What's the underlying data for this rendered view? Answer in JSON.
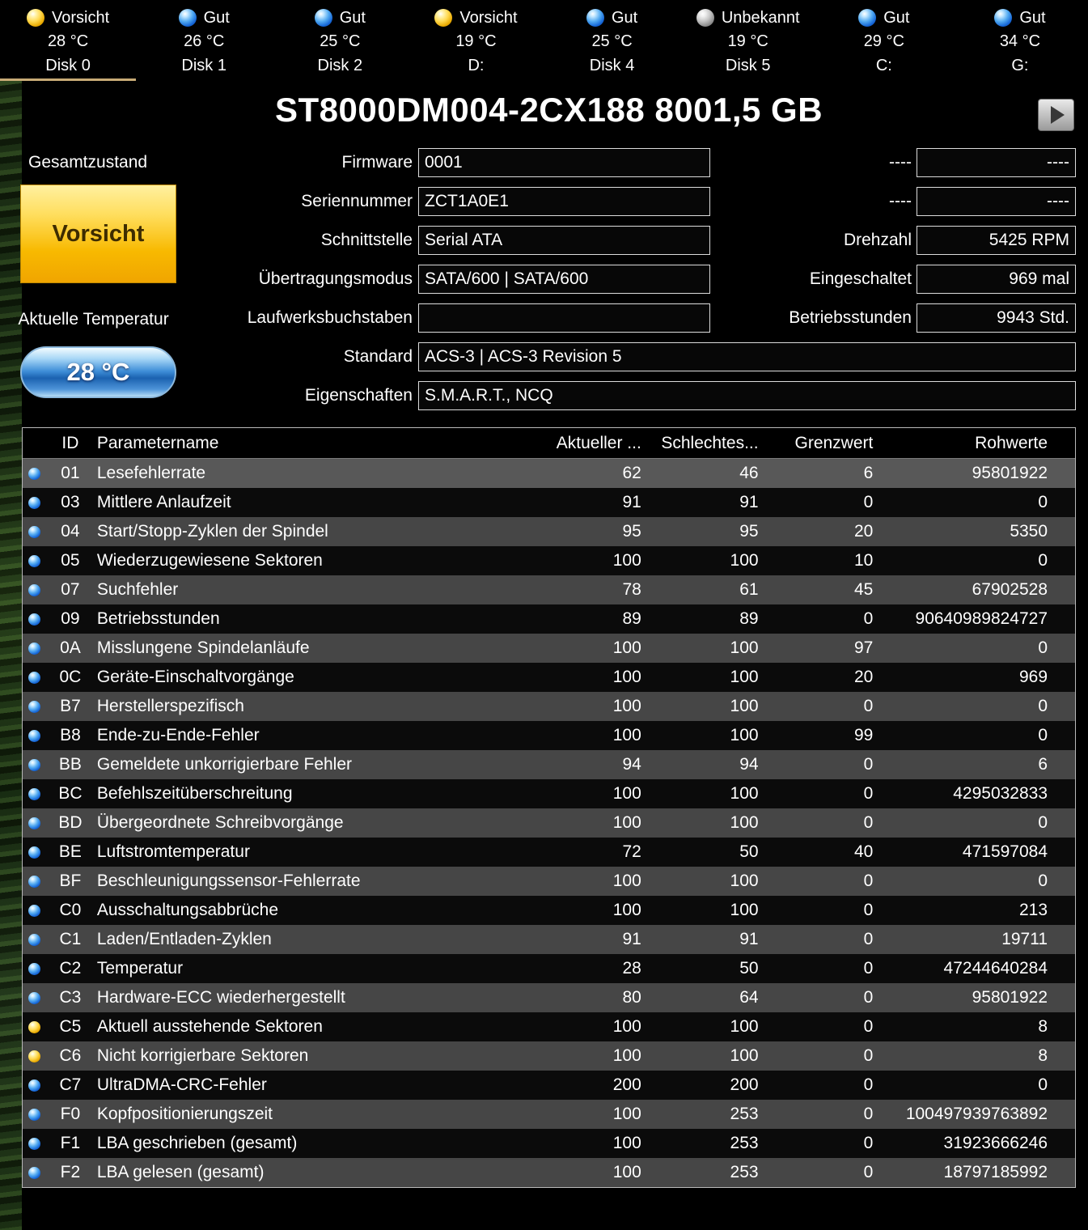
{
  "title": "ST8000DM004-2CX188 8001,5 GB",
  "tabs": [
    {
      "status": "Vorsicht",
      "temp": "28 °C",
      "name": "Disk 0",
      "color": "yellow",
      "active": true
    },
    {
      "status": "Gut",
      "temp": "26 °C",
      "name": "Disk 1",
      "color": "blue"
    },
    {
      "status": "Gut",
      "temp": "25 °C",
      "name": "Disk 2",
      "color": "blue"
    },
    {
      "status": "Vorsicht",
      "temp": "19 °C",
      "name": "D:",
      "color": "yellow"
    },
    {
      "status": "Gut",
      "temp": "25 °C",
      "name": "Disk 4",
      "color": "blue"
    },
    {
      "status": "Unbekannt",
      "temp": "19 °C",
      "name": "Disk 5",
      "color": "gray"
    },
    {
      "status": "Gut",
      "temp": "29 °C",
      "name": "C:",
      "color": "blue"
    },
    {
      "status": "Gut",
      "temp": "34 °C",
      "name": "G:",
      "color": "blue"
    }
  ],
  "health": {
    "label": "Gesamtzustand",
    "value": "Vorsicht"
  },
  "temperature": {
    "label": "Aktuelle Temperatur",
    "value": "28 °C"
  },
  "fields_mid": [
    {
      "label": "Firmware",
      "value": "0001",
      "size": "narrow"
    },
    {
      "label": "Seriennummer",
      "value": "ZCT1A0E1",
      "size": "narrow"
    },
    {
      "label": "Schnittstelle",
      "value": "Serial ATA",
      "size": "narrow"
    },
    {
      "label": "Übertragungsmodus",
      "value": "SATA/600 | SATA/600",
      "size": "narrow"
    },
    {
      "label": "Laufwerksbuchstaben",
      "value": "",
      "size": "narrow"
    },
    {
      "label": "Standard",
      "value": "ACS-3 | ACS-3 Revision 5",
      "size": "wide"
    },
    {
      "label": "Eigenschaften",
      "value": "S.M.A.R.T., NCQ",
      "size": "wide"
    }
  ],
  "fields_right": [
    {
      "label": "----",
      "value": "----"
    },
    {
      "label": "----",
      "value": "----"
    },
    {
      "label": "Drehzahl",
      "value": "5425 RPM"
    },
    {
      "label": "Eingeschaltet",
      "value": "969 mal"
    },
    {
      "label": "Betriebsstunden",
      "value": "9943 Std."
    }
  ],
  "table": {
    "headers": {
      "id": "ID",
      "name": "Parametername",
      "current": "Aktueller ...",
      "worst": "Schlechtes...",
      "threshold": "Grenzwert",
      "raw": "Rohwerte"
    },
    "rows": [
      {
        "dot": "blue",
        "id": "01",
        "name": "Lesefehlerrate",
        "current": "62",
        "worst": "46",
        "threshold": "6",
        "raw": "95801922"
      },
      {
        "dot": "blue",
        "id": "03",
        "name": "Mittlere Anlaufzeit",
        "current": "91",
        "worst": "91",
        "threshold": "0",
        "raw": "0"
      },
      {
        "dot": "blue",
        "id": "04",
        "name": "Start/Stopp-Zyklen der Spindel",
        "current": "95",
        "worst": "95",
        "threshold": "20",
        "raw": "5350"
      },
      {
        "dot": "blue",
        "id": "05",
        "name": "Wiederzugewiesene Sektoren",
        "current": "100",
        "worst": "100",
        "threshold": "10",
        "raw": "0"
      },
      {
        "dot": "blue",
        "id": "07",
        "name": "Suchfehler",
        "current": "78",
        "worst": "61",
        "threshold": "45",
        "raw": "67902528"
      },
      {
        "dot": "blue",
        "id": "09",
        "name": "Betriebsstunden",
        "current": "89",
        "worst": "89",
        "threshold": "0",
        "raw": "90640989824727"
      },
      {
        "dot": "blue",
        "id": "0A",
        "name": "Misslungene Spindelanläufe",
        "current": "100",
        "worst": "100",
        "threshold": "97",
        "raw": "0"
      },
      {
        "dot": "blue",
        "id": "0C",
        "name": "Geräte-Einschaltvorgänge",
        "current": "100",
        "worst": "100",
        "threshold": "20",
        "raw": "969"
      },
      {
        "dot": "blue",
        "id": "B7",
        "name": "Herstellerspezifisch",
        "current": "100",
        "worst": "100",
        "threshold": "0",
        "raw": "0"
      },
      {
        "dot": "blue",
        "id": "B8",
        "name": "Ende-zu-Ende-Fehler",
        "current": "100",
        "worst": "100",
        "threshold": "99",
        "raw": "0"
      },
      {
        "dot": "blue",
        "id": "BB",
        "name": "Gemeldete unkorrigierbare Fehler",
        "current": "94",
        "worst": "94",
        "threshold": "0",
        "raw": "6"
      },
      {
        "dot": "blue",
        "id": "BC",
        "name": "Befehlszeitüberschreitung",
        "current": "100",
        "worst": "100",
        "threshold": "0",
        "raw": "4295032833"
      },
      {
        "dot": "blue",
        "id": "BD",
        "name": "Übergeordnete Schreibvorgänge",
        "current": "100",
        "worst": "100",
        "threshold": "0",
        "raw": "0"
      },
      {
        "dot": "blue",
        "id": "BE",
        "name": "Luftstromtemperatur",
        "current": "72",
        "worst": "50",
        "threshold": "40",
        "raw": "471597084"
      },
      {
        "dot": "blue",
        "id": "BF",
        "name": "Beschleunigungssensor-Fehlerrate",
        "current": "100",
        "worst": "100",
        "threshold": "0",
        "raw": "0"
      },
      {
        "dot": "blue",
        "id": "C0",
        "name": "Ausschaltungsabbrüche",
        "current": "100",
        "worst": "100",
        "threshold": "0",
        "raw": "213"
      },
      {
        "dot": "blue",
        "id": "C1",
        "name": "Laden/Entladen-Zyklen",
        "current": "91",
        "worst": "91",
        "threshold": "0",
        "raw": "19711"
      },
      {
        "dot": "blue",
        "id": "C2",
        "name": "Temperatur",
        "current": "28",
        "worst": "50",
        "threshold": "0",
        "raw": "47244640284"
      },
      {
        "dot": "blue",
        "id": "C3",
        "name": "Hardware-ECC wiederhergestellt",
        "current": "80",
        "worst": "64",
        "threshold": "0",
        "raw": "95801922"
      },
      {
        "dot": "yellow",
        "id": "C5",
        "name": "Aktuell ausstehende Sektoren",
        "current": "100",
        "worst": "100",
        "threshold": "0",
        "raw": "8"
      },
      {
        "dot": "yellow",
        "id": "C6",
        "name": "Nicht korrigierbare Sektoren",
        "current": "100",
        "worst": "100",
        "threshold": "0",
        "raw": "8"
      },
      {
        "dot": "blue",
        "id": "C7",
        "name": "UltraDMA-CRC-Fehler",
        "current": "200",
        "worst": "200",
        "threshold": "0",
        "raw": "0"
      },
      {
        "dot": "blue",
        "id": "F0",
        "name": "Kopfpositionierungszeit",
        "current": "100",
        "worst": "253",
        "threshold": "0",
        "raw": "100497939763892"
      },
      {
        "dot": "blue",
        "id": "F1",
        "name": "LBA geschrieben (gesamt)",
        "current": "100",
        "worst": "253",
        "threshold": "0",
        "raw": "31923666246"
      },
      {
        "dot": "blue",
        "id": "F2",
        "name": "LBA gelesen (gesamt)",
        "current": "100",
        "worst": "253",
        "threshold": "0",
        "raw": "18797185992"
      }
    ]
  }
}
